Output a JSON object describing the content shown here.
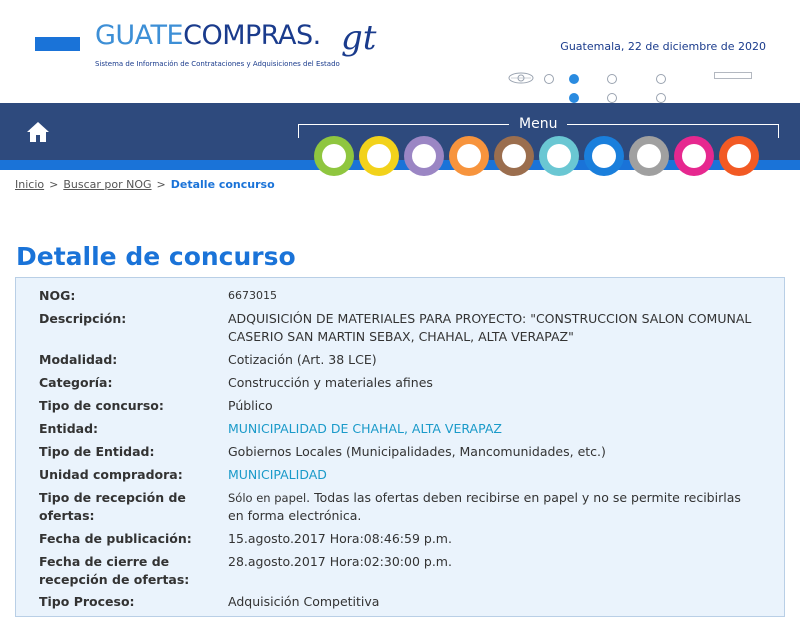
{
  "header": {
    "logo_guate": "GUATE",
    "logo_compras": "COMPRAS",
    "logo_dot": ".",
    "logo_gt": "gt",
    "logo_subtitle": "Sistema de Información de Contrataciones y Adquisiciones del Estado",
    "date": "Guatemala, 22 de diciembre de 2020"
  },
  "nav": {
    "menu_label": "Menu",
    "menu_circles": [
      {
        "color": "#8fc63f"
      },
      {
        "color": "#f2d21b"
      },
      {
        "color": "#9b86c4"
      },
      {
        "color": "#f7943d"
      },
      {
        "color": "#9b6e4e"
      },
      {
        "color": "#6ac7d3"
      },
      {
        "color": "#1a7fdc"
      },
      {
        "color": "#a0a0a0"
      },
      {
        "color": "#e6288f"
      },
      {
        "color": "#f25a24"
      }
    ]
  },
  "breadcrumb": {
    "items": [
      "Inicio",
      "Buscar por NOG"
    ],
    "current": "Detalle concurso",
    "separator": ">"
  },
  "page_title": "Detalle de concurso",
  "details": [
    {
      "label": "NOG:",
      "value": "6673015"
    },
    {
      "label": "Descripción:",
      "value": "ADQUISICIÓN DE MATERIALES PARA PROYECTO: \"CONSTRUCCION SALON COMUNAL CASERIO SAN MARTIN SEBAX, CHAHAL, ALTA VERAPAZ\""
    },
    {
      "label": "Modalidad:",
      "value": "Cotización (Art. 38 LCE)"
    },
    {
      "label": "Categoría:",
      "value": "Construcción y materiales afines"
    },
    {
      "label": "Tipo de concurso:",
      "value": "Público"
    },
    {
      "label": "Entidad:",
      "value": "MUNICIPALIDAD DE CHAHAL, ALTA VERAPAZ"
    },
    {
      "label": "Tipo de Entidad:",
      "value": "Gobiernos Locales (Municipalidades, Mancomunidades, etc.)"
    },
    {
      "label": "Unidad compradora:",
      "value": "MUNICIPALIDAD"
    },
    {
      "label": "Tipo de recepción de ofertas:",
      "value_strong": "Sólo en papel",
      "value": ". Todas las ofertas deben recibirse en papel y no se permite recibirlas en forma electrónica."
    },
    {
      "label": "Fecha de publicación:",
      "value": "15.agosto.2017 Hora:08:46:59 p.m."
    },
    {
      "label": "Fecha de cierre de recepción de ofertas:",
      "value": "28.agosto.2017 Hora:02:30:00 p.m."
    },
    {
      "label": "Tipo Proceso:",
      "value": "Adquisición Competitiva"
    }
  ]
}
